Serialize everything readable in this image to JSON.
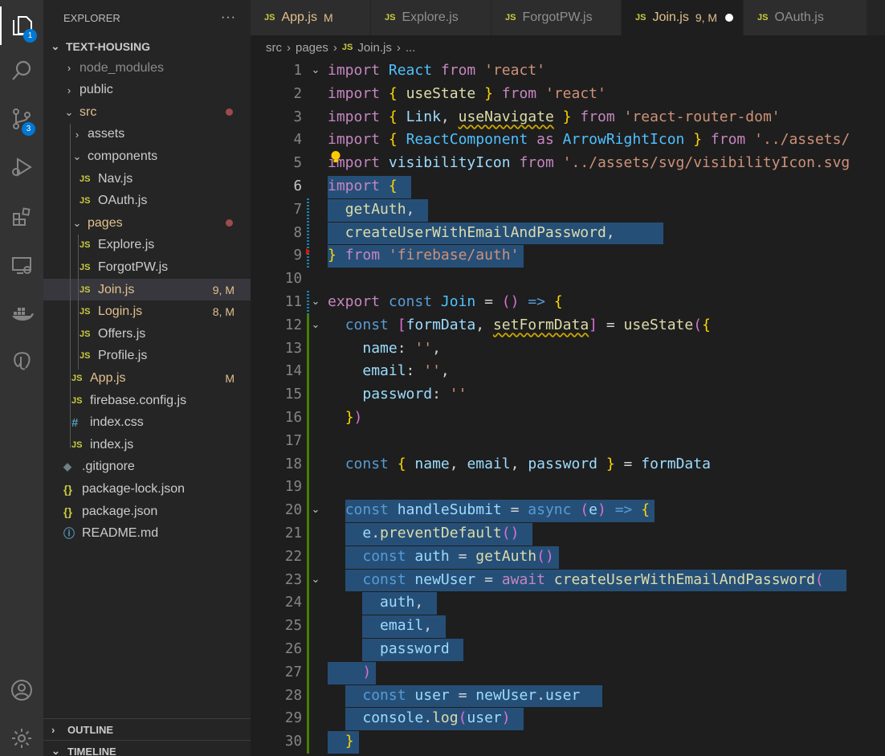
{
  "activity_bar": {
    "items": [
      {
        "name": "explorer",
        "badge": "1"
      },
      {
        "name": "search",
        "badge": ""
      },
      {
        "name": "source-control",
        "badge": "3"
      },
      {
        "name": "run-debug",
        "badge": ""
      },
      {
        "name": "extensions",
        "badge": ""
      },
      {
        "name": "remote-explorer",
        "badge": ""
      },
      {
        "name": "docker",
        "badge": ""
      },
      {
        "name": "postgresql",
        "badge": ""
      }
    ],
    "bottom": [
      {
        "name": "accounts"
      },
      {
        "name": "manage"
      }
    ]
  },
  "sidebar": {
    "title": "EXPLORER",
    "more": "···",
    "root": "TEXT-HOUSING",
    "items": [
      {
        "label": "node_modules",
        "kind": "folder",
        "open": false,
        "depth": 1,
        "status": "",
        "color": "#8c8c8c"
      },
      {
        "label": "public",
        "kind": "folder",
        "open": false,
        "depth": 1,
        "status": "",
        "color": "#cccccc"
      },
      {
        "label": "src",
        "kind": "folder",
        "open": true,
        "depth": 1,
        "status": "dot",
        "color": "#e2c08d"
      },
      {
        "label": "assets",
        "kind": "folder",
        "open": false,
        "depth": 2,
        "status": "",
        "color": "#cccccc"
      },
      {
        "label": "components",
        "kind": "folder",
        "open": true,
        "depth": 2,
        "status": "",
        "color": "#cccccc"
      },
      {
        "label": "Nav.js",
        "kind": "js",
        "depth": 3,
        "status": "",
        "color": "#cccccc"
      },
      {
        "label": "OAuth.js",
        "kind": "js",
        "depth": 3,
        "status": "",
        "color": "#cccccc"
      },
      {
        "label": "pages",
        "kind": "folder",
        "open": true,
        "depth": 2,
        "status": "dot",
        "color": "#e2c08d"
      },
      {
        "label": "Explore.js",
        "kind": "js",
        "depth": 3,
        "status": "",
        "color": "#cccccc"
      },
      {
        "label": "ForgotPW.js",
        "kind": "js",
        "depth": 3,
        "status": "",
        "color": "#cccccc"
      },
      {
        "label": "Join.js",
        "kind": "js",
        "depth": 3,
        "status": "9, M",
        "color": "#e2c08d",
        "selected": true
      },
      {
        "label": "Login.js",
        "kind": "js",
        "depth": 3,
        "status": "8, M",
        "color": "#e2c08d"
      },
      {
        "label": "Offers.js",
        "kind": "js",
        "depth": 3,
        "status": "",
        "color": "#cccccc"
      },
      {
        "label": "Profile.js",
        "kind": "js",
        "depth": 3,
        "status": "",
        "color": "#cccccc"
      },
      {
        "label": "App.js",
        "kind": "js",
        "depth": 2,
        "status": "M",
        "color": "#e2c08d"
      },
      {
        "label": "firebase.config.js",
        "kind": "js",
        "depth": 2,
        "status": "",
        "color": "#cccccc"
      },
      {
        "label": "index.css",
        "kind": "css",
        "depth": 2,
        "status": "",
        "color": "#cccccc"
      },
      {
        "label": "index.js",
        "kind": "js",
        "depth": 2,
        "status": "",
        "color": "#cccccc"
      },
      {
        "label": ".gitignore",
        "kind": "git",
        "depth": 1,
        "status": "",
        "color": "#cccccc"
      },
      {
        "label": "package-lock.json",
        "kind": "json",
        "depth": 1,
        "status": "",
        "color": "#cccccc"
      },
      {
        "label": "package.json",
        "kind": "json",
        "depth": 1,
        "status": "",
        "color": "#cccccc"
      },
      {
        "label": "README.md",
        "kind": "info",
        "depth": 1,
        "status": "",
        "color": "#cccccc"
      }
    ],
    "sections": [
      "OUTLINE",
      "TIMELINE"
    ]
  },
  "tabs": [
    {
      "label": "App.js",
      "status": "M",
      "active": false,
      "color": "#e2c08d"
    },
    {
      "label": "Explore.js",
      "status": "",
      "active": false,
      "color": "#8f8f8f"
    },
    {
      "label": "ForgotPW.js",
      "status": "",
      "active": false,
      "color": "#8f8f8f"
    },
    {
      "label": "Join.js",
      "status": "9, M",
      "active": true,
      "dirty": true,
      "color": "#e2c08d"
    },
    {
      "label": "OAuth.js",
      "status": "",
      "active": false,
      "color": "#8f8f8f"
    }
  ],
  "breadcrumb": [
    "src",
    "pages",
    "Join.js",
    "..."
  ],
  "editor": {
    "lines": [
      "import React from 'react'",
      "import { useState } from 'react'",
      "import { Link, useNavigate } from 'react-router-dom'",
      "import { ReactComponent as ArrowRightIcon } from '../assets/",
      "import visibilityIcon from '../assets/svg/visibilityIcon.svg",
      "import {",
      "  getAuth,",
      "  createUserWithEmailAndPassword,",
      "} from 'firebase/auth'",
      "",
      "export const Join = () => {",
      "  const [formData, setFormData] = useState({",
      "    name: '',",
      "    email: '',",
      "    password: ''",
      "  })",
      "",
      "  const { name, email, password } = formData",
      "",
      "  const handleSubmit = async (e) => {",
      "    e.preventDefault()",
      "    const auth = getAuth()",
      "    const newUser = await createUserWithEmailAndPassword(",
      "      auth,",
      "      email,",
      "      password",
      "    )",
      "    const user = newUser.user",
      "    console.log(user)",
      "  }"
    ],
    "line_numbers": [
      "1",
      "2",
      "3",
      "4",
      "5",
      "6",
      "7",
      "8",
      "9",
      "10",
      "11",
      "12",
      "13",
      "14",
      "15",
      "16",
      "17",
      "18",
      "19",
      "20",
      "21",
      "22",
      "23",
      "24",
      "25",
      "26",
      "27",
      "28",
      "29",
      "30"
    ],
    "fold_lines": [
      1,
      11,
      12,
      20,
      23
    ],
    "cursor_line": 6,
    "colors": {
      "keyword": "#c586c0",
      "storage": "#569cd6",
      "string": "#ce9178",
      "variable": "#9cdcfe",
      "function": "#dcdcaa",
      "constant": "#4fc1ff",
      "selection": "#264f78"
    }
  }
}
